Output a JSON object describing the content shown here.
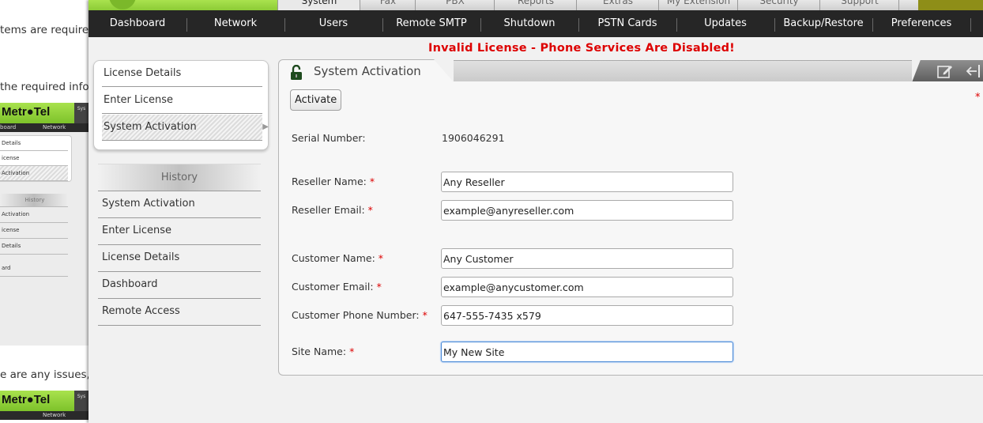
{
  "background_doc": {
    "line1": "tems are required",
    "line2": "the required inform",
    "line3": "e are any issues, f",
    "thumb": {
      "logo_text": "Metr●Tel",
      "side_tab": "Sys",
      "nav1": "board",
      "nav2": "Network",
      "items": [
        "Details",
        "icense",
        "Activation"
      ],
      "history_header": "History",
      "history": [
        "Activation",
        "icense",
        "Details",
        "ard"
      ]
    }
  },
  "top_tabs": [
    "System",
    "Fax",
    "PBX",
    "Reports",
    "Extras",
    "My Extension",
    "Security",
    "Support"
  ],
  "nav": [
    "Dashboard",
    "Network",
    "Users",
    "Remote SMTP",
    "Shutdown",
    "PSTN Cards",
    "Updates",
    "Backup/Restore",
    "Preferences"
  ],
  "banner": "Invalid License - Phone Services Are Disabled!",
  "sidebar": {
    "items": [
      "License Details",
      "Enter License",
      "System Activation"
    ],
    "selected": "System Activation",
    "arrow": "▶"
  },
  "history": {
    "header": "History",
    "items": [
      "System Activation",
      "Enter License",
      "License Details",
      "Dashboard",
      "Remote Access"
    ]
  },
  "panel": {
    "title": "System Activation",
    "activate_button": "Activate",
    "required_marker": "*",
    "serial_label": "Serial Number:",
    "serial_value": "1906046291",
    "fields": {
      "reseller_name": {
        "label": "Reseller Name:",
        "value": "Any Reseller"
      },
      "reseller_email": {
        "label": "Reseller Email:",
        "value": "example@anyreseller.com"
      },
      "customer_name": {
        "label": "Customer Name:",
        "value": "Any Customer"
      },
      "customer_email": {
        "label": "Customer Email:",
        "value": "example@anycustomer.com"
      },
      "customer_phone": {
        "label": "Customer Phone Number:",
        "value": "647-555-7435 x579"
      },
      "site_name": {
        "label": "Site Name:",
        "value": "My New Site"
      }
    },
    "star": "*"
  },
  "colors": {
    "banner": "#dd0000",
    "nav_bg": "#262626",
    "brand_green": "#8ccb36",
    "focus_border": "#4b8ad6"
  }
}
